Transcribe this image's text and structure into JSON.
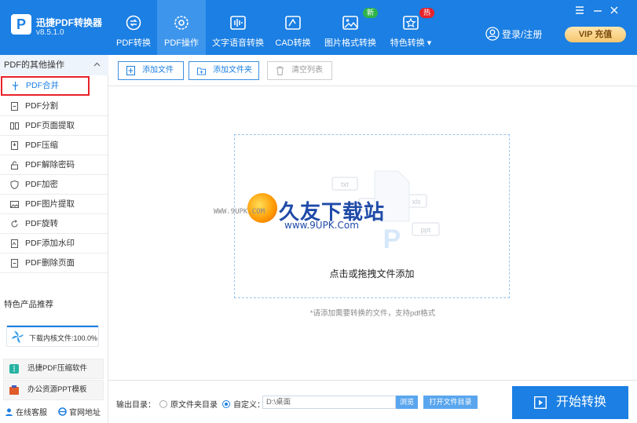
{
  "app": {
    "name": "迅捷PDF转换器",
    "version": "v8.5.1.0",
    "logo_letter": "P"
  },
  "nav": [
    {
      "label": "PDF转换",
      "icon": "convert-icon",
      "active": false
    },
    {
      "label": "PDF操作",
      "icon": "gear-icon",
      "active": true
    },
    {
      "label": "文字语音转换",
      "icon": "audio-wave-icon",
      "active": false
    },
    {
      "label": "CAD转换",
      "icon": "cad-icon",
      "active": false
    },
    {
      "label": "图片格式转换",
      "icon": "image-icon",
      "active": false,
      "badge": "新",
      "badge_color": "#2fb44a"
    },
    {
      "label": "特色转换 ▾",
      "icon": "star-box-icon",
      "active": false,
      "badge": "热",
      "badge_color": "#e8232a"
    }
  ],
  "header": {
    "login": "登录/注册",
    "vip": "VIP 充值"
  },
  "sidebar": {
    "title": "PDF的其他操作",
    "items": [
      {
        "label": "PDF合并",
        "active": true
      },
      {
        "label": "PDF分割"
      },
      {
        "label": "PDF页面提取"
      },
      {
        "label": "PDF压缩"
      },
      {
        "label": "PDF解除密码"
      },
      {
        "label": "PDF加密"
      },
      {
        "label": "PDF图片提取"
      },
      {
        "label": "PDF旋转"
      },
      {
        "label": "PDF添加水印"
      },
      {
        "label": "PDF删除页面"
      }
    ],
    "promo_title": "特色产品推荐",
    "download_card": {
      "text": "下载内核文件:100.0%",
      "progress": 1.0
    },
    "promos": [
      {
        "label": "迅捷PDF压缩软件"
      },
      {
        "label": "办公资源PPT模板"
      }
    ],
    "footer": {
      "service": "在线客服",
      "website": "官网地址"
    }
  },
  "toolbar": {
    "add_file": "添加文件",
    "add_folder": "添加文件夹",
    "clear_list": "清空列表"
  },
  "dropzone": {
    "text": "点击或拖拽文件添加",
    "art_labels": [
      "txt",
      "xls",
      "ppt",
      "doc"
    ]
  },
  "watermark": {
    "brand": "久友下载站",
    "url_small": "WWW.9UPK.COM",
    "url": "www.9UPK.Com"
  },
  "hint": "*请添加需要转换的文件，支持pdf格式",
  "output": {
    "label": "输出目录：",
    "option_original": "原文件夹目录",
    "option_custom": "自定义：",
    "path": "D:\\桌面",
    "browse": "浏览",
    "open_folder": "打开文件目录",
    "start": "开始转换"
  },
  "colors": {
    "primary": "#1b7fe3",
    "highlight_border": "#e8232a"
  }
}
